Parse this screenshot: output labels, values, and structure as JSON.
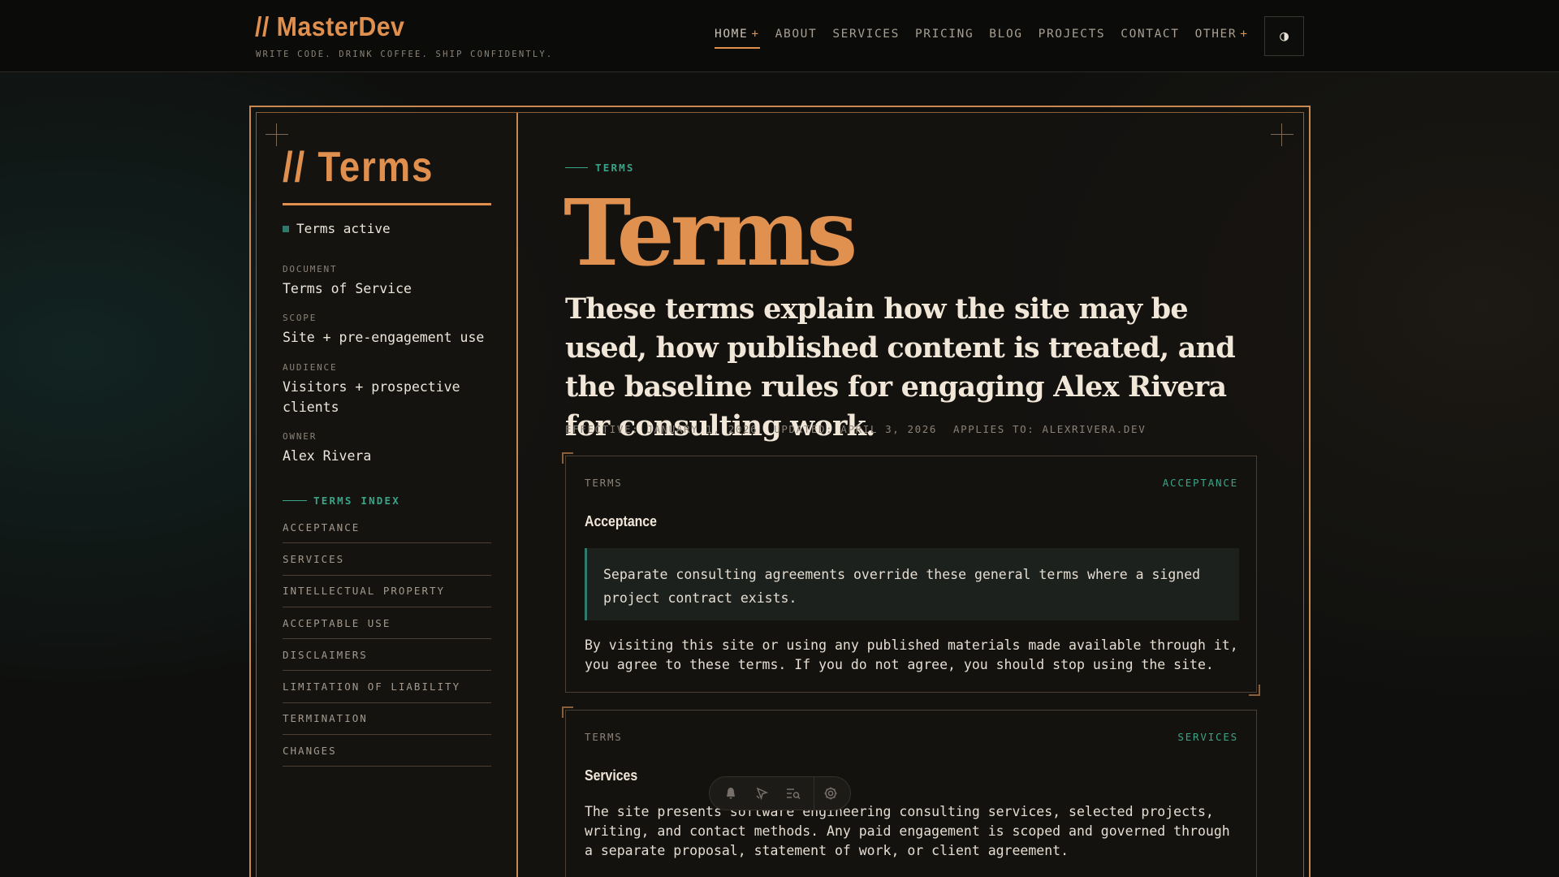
{
  "header": {
    "logo": "// MasterDev",
    "tagline": "WRITE CODE. DRINK COFFEE. SHIP CONFIDENTLY.",
    "nav": [
      {
        "label": "HOME",
        "plus": "+"
      },
      {
        "label": "ABOUT",
        "plus": ""
      },
      {
        "label": "SERVICES",
        "plus": ""
      },
      {
        "label": "PRICING",
        "plus": ""
      },
      {
        "label": "BLOG",
        "plus": ""
      },
      {
        "label": "PROJECTS",
        "plus": ""
      },
      {
        "label": "CONTACT",
        "plus": ""
      },
      {
        "label": "OTHER",
        "plus": "+"
      }
    ],
    "theme_icon": "◑"
  },
  "sidebar": {
    "title": "// Terms",
    "status": "Terms active",
    "meta": [
      {
        "label": "DOCUMENT",
        "value": "Terms of Service"
      },
      {
        "label": "SCOPE",
        "value": "Site + pre-engagement use"
      },
      {
        "label": "AUDIENCE",
        "value": "Visitors + prospective clients"
      },
      {
        "label": "OWNER",
        "value": "Alex Rivera"
      }
    ],
    "index_heading": "TERMS INDEX",
    "index": [
      "ACCEPTANCE",
      "SERVICES",
      "INTELLECTUAL PROPERTY",
      "ACCEPTABLE USE",
      "DISCLAIMERS",
      "LIMITATION OF LIABILITY",
      "TERMINATION",
      "CHANGES"
    ]
  },
  "main": {
    "eyebrow": "TERMS",
    "title": "Terms",
    "lede": "These terms explain how the site may be used, how published content is treated, and the baseline rules for engaging Alex Rivera for consulting work.",
    "effective": "EFFECTIVE: JANUARY 1, 2026",
    "updated": "UPDATED: APRIL 3, 2026",
    "applies": "APPLIES TO: ALEXRIVERA.DEV",
    "cards": [
      {
        "kicker": "TERMS",
        "tag": "ACCEPTANCE",
        "title": "Acceptance",
        "callout": "Separate consulting agreements override these general terms where a signed project contract exists.",
        "body": "By visiting this site or using any published materials made available through it, you agree to these terms. If you do not agree, you should stop using the site."
      },
      {
        "kicker": "TERMS",
        "tag": "SERVICES",
        "title": "Services",
        "body": "The site presents software engineering consulting services, selected projects, writing, and contact methods. Any paid engagement is scoped and governed through a separate proposal, statement of work, or client agreement."
      }
    ]
  },
  "toolbar": {
    "icons": [
      "bell-icon",
      "cursor-icon",
      "search-list-icon",
      "gear-icon"
    ]
  }
}
